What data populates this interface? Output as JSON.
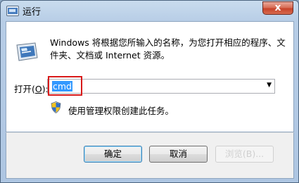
{
  "window": {
    "title": "运行",
    "close_label": "x"
  },
  "dialog": {
    "description": "Windows 将根据您所输入的名称，为您打开相应的程序、文件夹、文档或 Internet 资源。",
    "open_label_prefix": "打开(",
    "open_label_key": "O",
    "open_label_suffix": "):",
    "command_value": "cmd",
    "admin_note": "使用管理权限创建此任务。"
  },
  "buttons": {
    "ok": "确定",
    "cancel": "取消",
    "browse": "浏览(B)..."
  },
  "colors": {
    "highlight_box": "#d81a1a",
    "selection": "#3399ff"
  }
}
